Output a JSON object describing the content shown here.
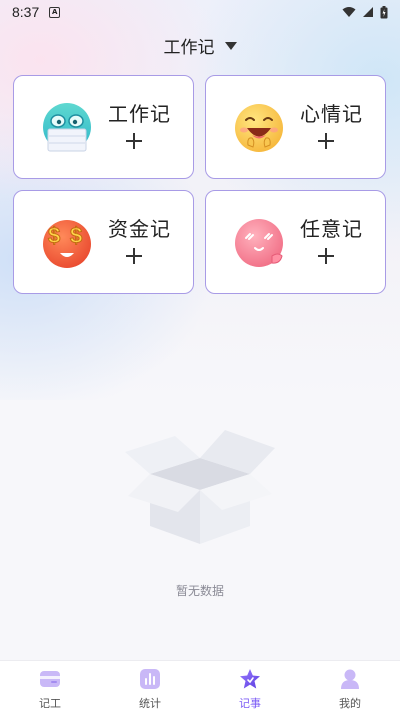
{
  "status_bar": {
    "time": "8:37",
    "notification_badge": "A"
  },
  "header": {
    "title": "工作记",
    "dropdown_icon": "caret-down-icon"
  },
  "cards": [
    {
      "label": "工作记",
      "emoji": "masked-face-emoji",
      "action": "plus-icon"
    },
    {
      "label": "心情记",
      "emoji": "grinning-face-emoji",
      "action": "plus-icon"
    },
    {
      "label": "资金记",
      "emoji": "money-face-emoji",
      "action": "plus-icon"
    },
    {
      "label": "任意记",
      "emoji": "blushing-face-emoji",
      "action": "plus-icon"
    }
  ],
  "empty_state": {
    "text": "暂无数据",
    "icon": "open-box-icon"
  },
  "tabbar": {
    "active_index": 2,
    "accent_color": "#7c5cf5",
    "tabs": [
      {
        "label": "记工",
        "icon": "wallet-icon"
      },
      {
        "label": "统计",
        "icon": "bar-chart-icon"
      },
      {
        "label": "记事",
        "icon": "star-icon"
      },
      {
        "label": "我的",
        "icon": "user-icon"
      }
    ]
  }
}
